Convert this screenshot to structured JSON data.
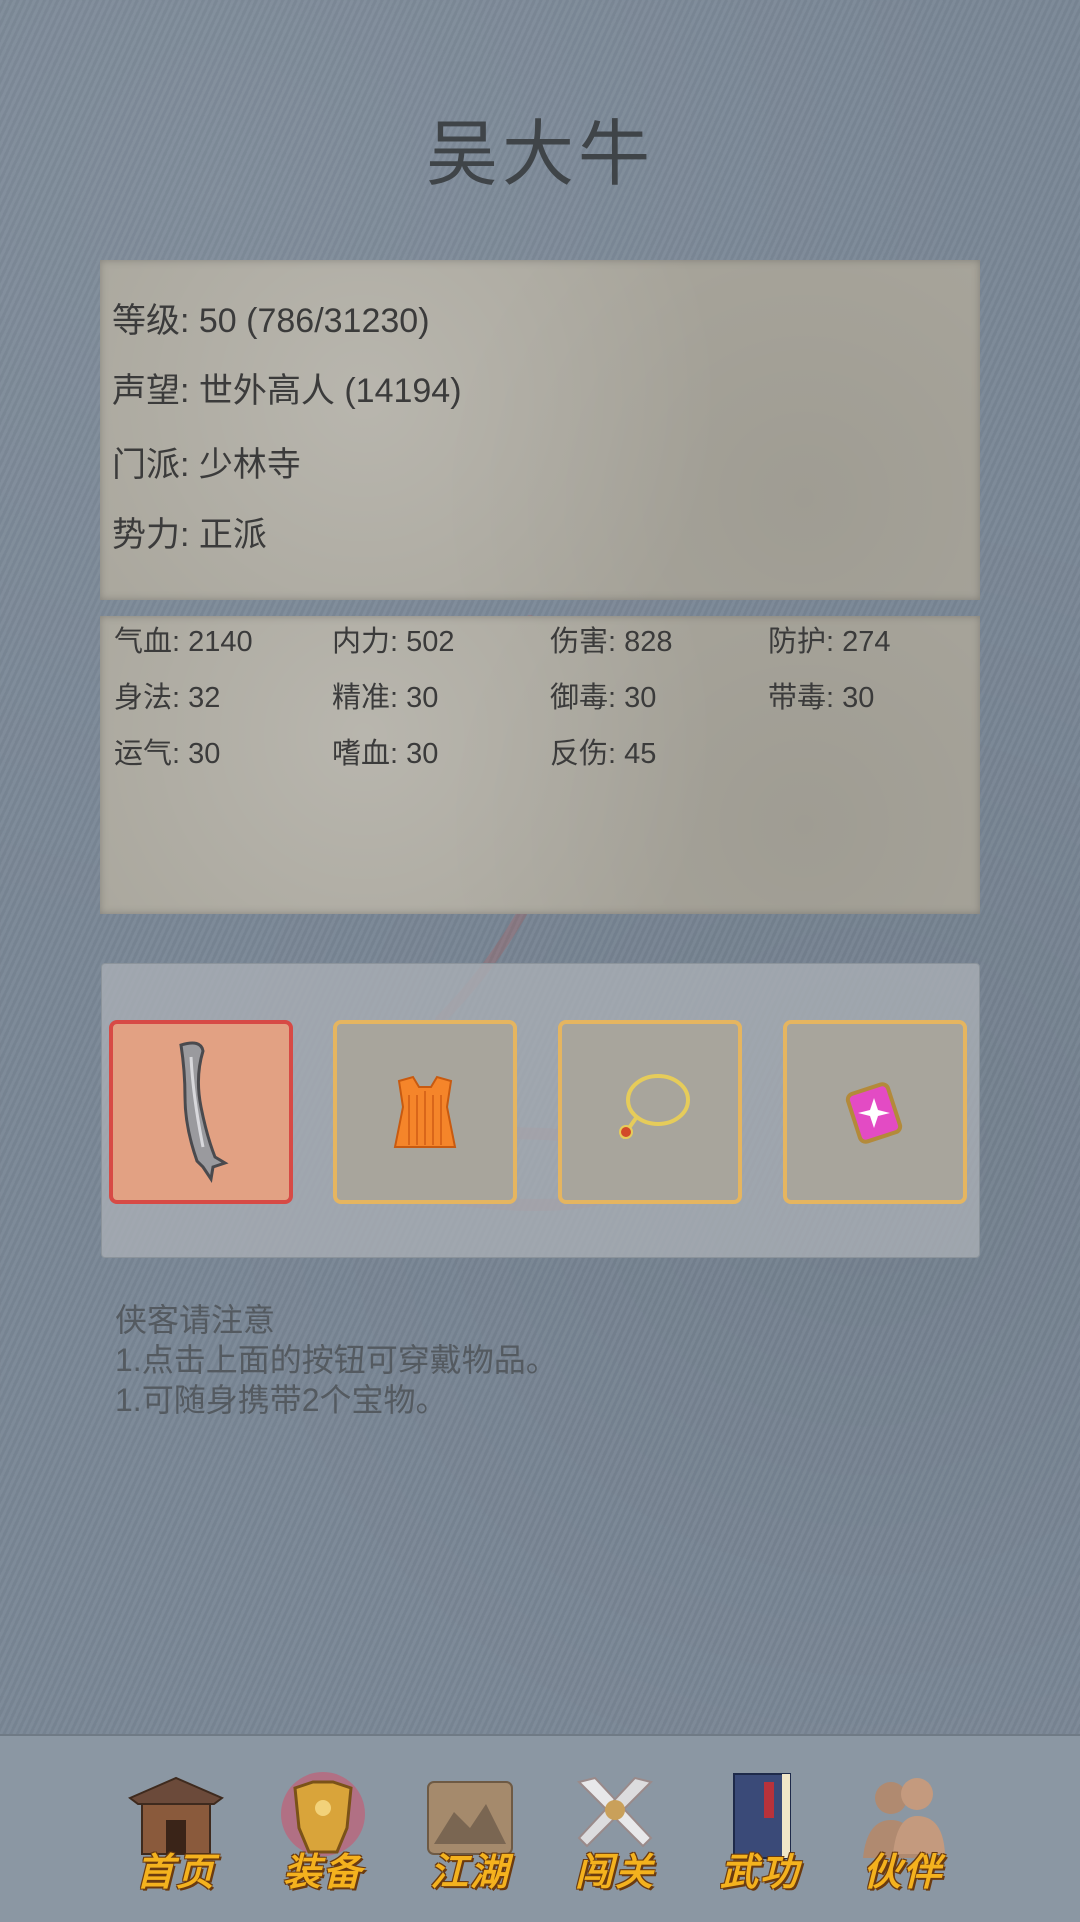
{
  "character": {
    "name": "吴大牛"
  },
  "info": {
    "level": "等级: 50 (786/31230)",
    "reputation": "声望: 世外高人 (14194)",
    "sect": "门派: 少林寺",
    "faction": "势力:  正派"
  },
  "stats": [
    "气血: 2140",
    "内力: 502",
    "伤害: 828",
    "防护: 274",
    "身法: 32",
    "精准: 30",
    "御毒: 30",
    "带毒: 30",
    "运气: 30",
    "嗜血: 30",
    "反伤: 45"
  ],
  "equipment": [
    {
      "icon": "blade-icon",
      "selected": true
    },
    {
      "icon": "armor-vest-icon",
      "selected": false
    },
    {
      "icon": "necklace-icon",
      "selected": false
    },
    {
      "icon": "gem-amulet-icon",
      "selected": false
    }
  ],
  "notice": {
    "heading": "侠客请注意",
    "line1": "1.点击上面的按钮可穿戴物品。",
    "line2": "1.可随身携带2个宝物。"
  },
  "nav": {
    "home": "首页",
    "equip": "装备",
    "world": "江湖",
    "stage": "闯关",
    "skills": "武功",
    "partner": "伙伴"
  },
  "colors": {
    "background": "#7a8796",
    "panel": "#a9a69c",
    "slot_border": "#e5b560",
    "slot_active_border": "#d74a45",
    "nav_label": "#f4b21e"
  }
}
